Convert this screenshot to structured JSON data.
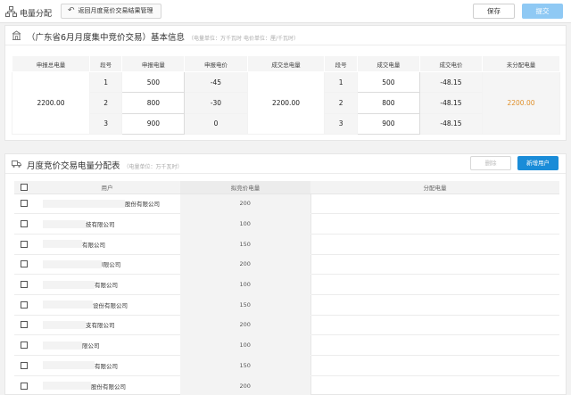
{
  "header": {
    "title": "电量分配",
    "back_label": "返回月度竞价交易结果管理",
    "save_label": "保存",
    "submit_label": "提交"
  },
  "basic_info": {
    "title": "（广东省6月月度集中竞价交易）基本信息",
    "subtitle": "（电量单位：万千瓦时 电价单位：厘/千瓦时）",
    "columns": [
      "申报总电量",
      "段号",
      "申报电量",
      "申报电价",
      "成交总电量",
      "段号",
      "成交电量",
      "成交电价",
      "未分配电量"
    ],
    "declared_total": "2200.00",
    "deal_total": "2200.00",
    "unallocated": "2200.00",
    "segments": [
      {
        "no": "1",
        "declared_qty": "500",
        "declared_price": "-45",
        "deal_no": "1",
        "deal_qty": "500",
        "deal_price": "-48.15"
      },
      {
        "no": "2",
        "declared_qty": "800",
        "declared_price": "-30",
        "deal_no": "2",
        "deal_qty": "800",
        "deal_price": "-48.15"
      },
      {
        "no": "3",
        "declared_qty": "900",
        "declared_price": "0",
        "deal_no": "3",
        "deal_qty": "900",
        "deal_price": "-48.15"
      }
    ],
    "colors": {
      "unallocated": "#e0902b"
    }
  },
  "allocation": {
    "title": "月度竞价交易电量分配表",
    "subtitle": "（电量单位：万千瓦时）",
    "delete_label": "删除",
    "add_label": "新增用户",
    "columns": [
      "用户",
      "拟竞价电量",
      "分配电量"
    ],
    "rows": [
      {
        "user": "股份有限公司",
        "qty": "200",
        "alloc": ""
      },
      {
        "user": "技有限公司",
        "qty": "100",
        "alloc": ""
      },
      {
        "user": "有限公司",
        "qty": "150",
        "alloc": ""
      },
      {
        "user": "l限公司",
        "qty": "200",
        "alloc": ""
      },
      {
        "user": "有限公司",
        "qty": "100",
        "alloc": ""
      },
      {
        "user": "设份有限公司",
        "qty": "150",
        "alloc": ""
      },
      {
        "user": "支有限公司",
        "qty": "200",
        "alloc": ""
      },
      {
        "user": "限公司",
        "qty": "100",
        "alloc": ""
      },
      {
        "user": "有限公司",
        "qty": "150",
        "alloc": ""
      },
      {
        "user": "股份有限公司",
        "qty": "200",
        "alloc": ""
      }
    ]
  }
}
